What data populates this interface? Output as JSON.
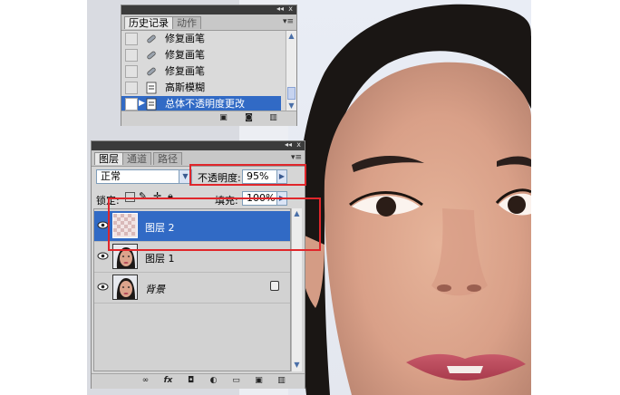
{
  "history_panel": {
    "tabs": [
      "历史记录",
      "动作"
    ],
    "items": [
      {
        "label": "修复画笔",
        "icon": "healing-brush-icon",
        "selected": false
      },
      {
        "label": "修复画笔",
        "icon": "healing-brush-icon",
        "selected": false
      },
      {
        "label": "修复画笔",
        "icon": "healing-brush-icon",
        "selected": false
      },
      {
        "label": "高斯模糊",
        "icon": "filter-document-icon",
        "selected": false
      },
      {
        "label": "总体不透明度更改",
        "icon": "filter-document-icon",
        "selected": true
      }
    ],
    "footer_icons": [
      "new-document-from-state-icon",
      "snapshot-camera-icon",
      "trash-icon"
    ]
  },
  "layers_panel": {
    "tabs": [
      "图层",
      "通道",
      "路径"
    ],
    "blend_mode": "正常",
    "opacity_label": "不透明度:",
    "opacity_value": "95%",
    "lock_label": "锁定:",
    "fill_label": "填充:",
    "fill_value": "100%",
    "layers": [
      {
        "name": "图层 2",
        "selected": true,
        "thumb": "transparent-checker"
      },
      {
        "name": "图层 1",
        "selected": false,
        "thumb": "face"
      },
      {
        "name": "背景",
        "selected": false,
        "thumb": "face",
        "locked": true
      }
    ],
    "footer_icons": [
      "link-icon",
      "fx-icon",
      "mask-icon",
      "adjustment-icon",
      "group-folder-icon",
      "new-layer-icon",
      "trash-icon"
    ]
  },
  "colors": {
    "selection": "#316ac5",
    "highlight_box": "#e0262b"
  }
}
